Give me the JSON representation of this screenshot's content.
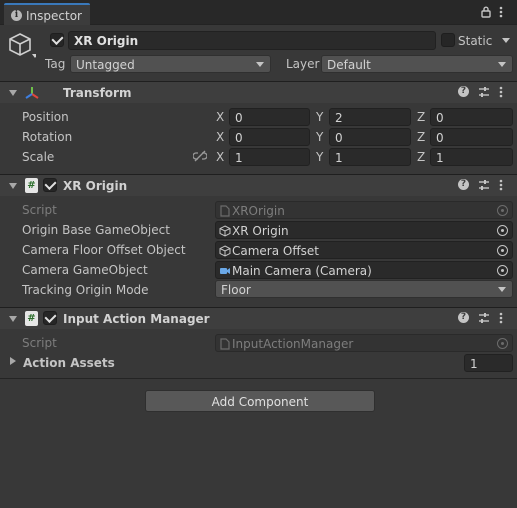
{
  "tab": {
    "title": "Inspector",
    "info_icon": "info-icon",
    "lock_icon": "lock-icon",
    "menu_icon": "kebab-menu-icon"
  },
  "gameobject": {
    "icon": "cube-icon",
    "active": true,
    "name": "XR Origin",
    "static_label": "Static",
    "static": false,
    "tag_label": "Tag",
    "tag_value": "Untagged",
    "layer_label": "Layer",
    "layer_value": "Default"
  },
  "transform": {
    "title": "Transform",
    "icon": "transform-axes-icon",
    "rows": [
      {
        "label": "Position",
        "x": "0",
        "y": "2",
        "z": "0"
      },
      {
        "label": "Rotation",
        "x": "0",
        "y": "0",
        "z": "0"
      },
      {
        "label": "Scale",
        "x": "1",
        "y": "1",
        "z": "1",
        "link_icon": "unlinked-scale-icon"
      }
    ],
    "axes": {
      "x": "X",
      "y": "Y",
      "z": "Z"
    }
  },
  "xr_origin": {
    "title": "XR Origin",
    "enabled": true,
    "icon": "csharp-script-icon",
    "script_label": "Script",
    "script_value": "XROrigin",
    "fields": [
      {
        "label": "Origin Base GameObject",
        "value": "XR Origin",
        "icon": "cube-icon"
      },
      {
        "label": "Camera Floor Offset Object",
        "value": "Camera Offset",
        "icon": "cube-icon"
      },
      {
        "label": "Camera GameObject",
        "value": "Main Camera (Camera)",
        "icon": "camera-icon"
      }
    ],
    "tracking_label": "Tracking Origin Mode",
    "tracking_value": "Floor"
  },
  "input_action_manager": {
    "title": "Input Action Manager",
    "enabled": true,
    "icon": "csharp-script-icon",
    "script_label": "Script",
    "script_value": "InputActionManager",
    "action_assets_label": "Action Assets",
    "action_assets_count": "1"
  },
  "add_component_label": "Add Component",
  "header_icons": [
    "help-icon",
    "preset-icon",
    "kebab-menu-icon"
  ],
  "colors": {
    "accent": "#3a79bb",
    "background": "#383838",
    "header": "#3e3e3e",
    "field": "#2a2a2a"
  }
}
